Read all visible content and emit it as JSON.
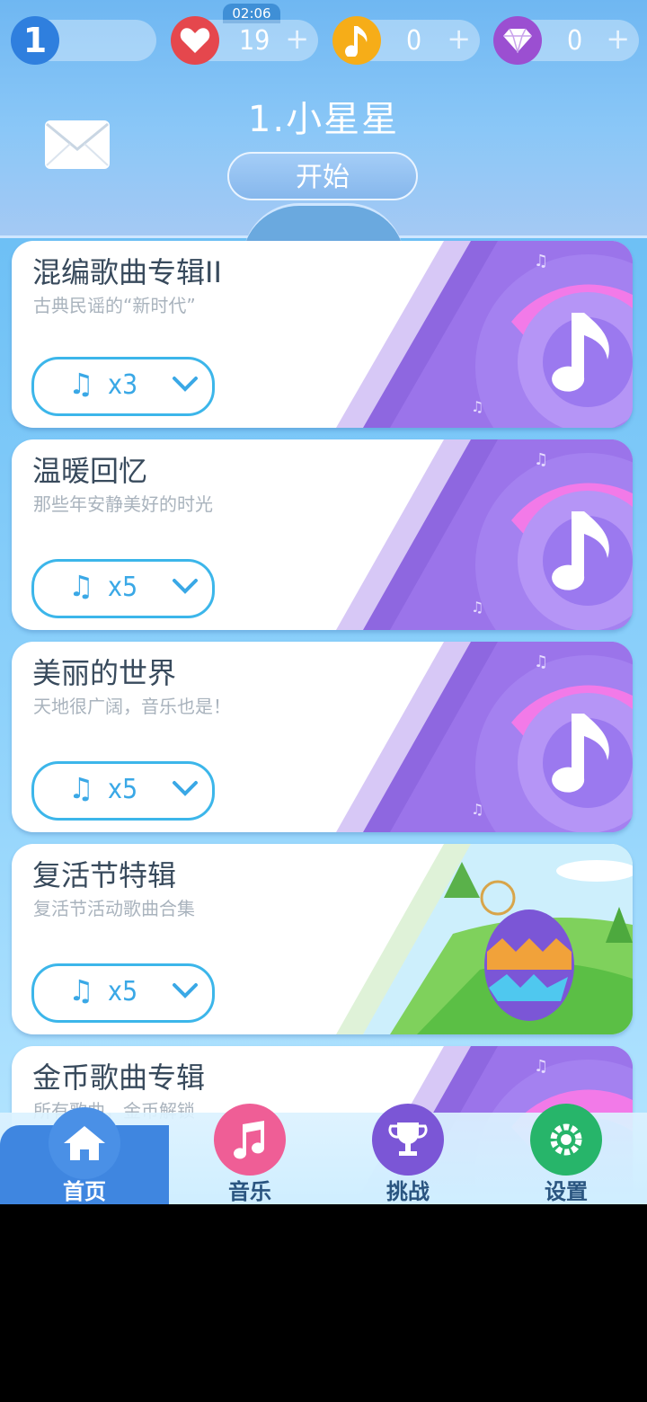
{
  "header": {
    "level": "1",
    "timer": "02:06",
    "lives": "19",
    "notes": "0",
    "diamonds": "0",
    "plus": "+",
    "song_title": "1.小星星",
    "start_label": "开始"
  },
  "albums": [
    {
      "title": "混编歌曲专辑II",
      "subtitle": "古典民谣的“新时代”",
      "count": "x3"
    },
    {
      "title": "温暖回忆",
      "subtitle": "那些年安静美好的时光",
      "count": "x5"
    },
    {
      "title": "美丽的世界",
      "subtitle": "天地很广阔，音乐也是！",
      "count": "x5"
    },
    {
      "title": "复活节特辑",
      "subtitle": "复活节活动歌曲合集",
      "count": "x5"
    },
    {
      "title": "金币歌曲专辑",
      "subtitle": "所有歌曲，金币解锁",
      "count": ""
    }
  ],
  "nav": {
    "home": "首页",
    "music": "音乐",
    "challenge": "挑战",
    "settings": "设置"
  },
  "colors": {
    "pill_blue": "#3cb6ea",
    "heart_red": "#e5474d",
    "note_orange": "#f6ad18",
    "diamond_purple": "#9b4fd1",
    "nav_active": "#3f86e0"
  }
}
